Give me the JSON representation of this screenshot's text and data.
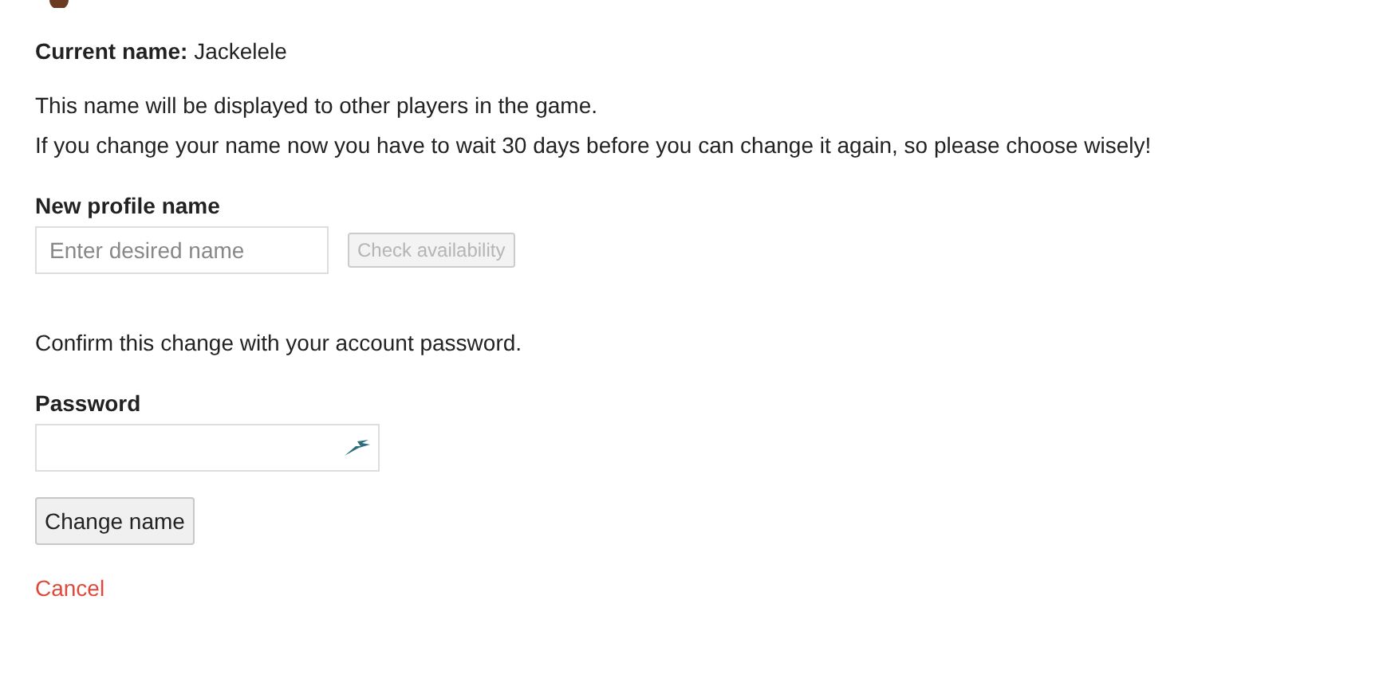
{
  "current_name": {
    "label": "Current name:",
    "value": "Jackelele"
  },
  "info": [
    "This name will be displayed to other players in the game.",
    "If you change your name now you have to wait 30 days before you can change it again, so please choose wisely!"
  ],
  "new_name": {
    "label": "New profile name",
    "placeholder": "Enter desired name",
    "check_button": {
      "label": "Check availability",
      "disabled": true
    }
  },
  "confirm_text": "Confirm this change with your account password.",
  "password": {
    "label": "Password"
  },
  "submit_button": "Change name",
  "cancel_link": "Cancel"
}
